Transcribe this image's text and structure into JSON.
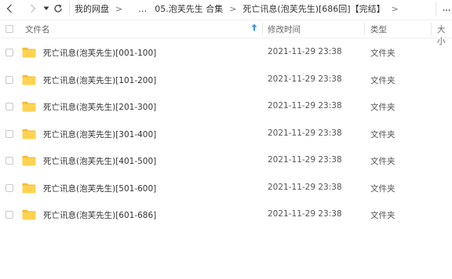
{
  "nav": {
    "breadcrumbs": [
      "我的网盘",
      "…",
      "05.泡芙先生 合集",
      "死亡讯息(泡芙先生)[686回]【完结】"
    ],
    "separator": ">"
  },
  "columns": {
    "name": "文件名",
    "modified": "修改时间",
    "type": "类型",
    "size": "大小"
  },
  "files": [
    {
      "name": "死亡讯息(泡芙先生)[001-100]",
      "modified": "2021-11-29 23:38",
      "type": "文件夹"
    },
    {
      "name": "死亡讯息(泡芙先生)[101-200]",
      "modified": "2021-11-29 23:38",
      "type": "文件夹"
    },
    {
      "name": "死亡讯息(泡芙先生)[201-300]",
      "modified": "2021-11-29 23:38",
      "type": "文件夹"
    },
    {
      "name": "死亡讯息(泡芙先生)[301-400]",
      "modified": "2021-11-29 23:38",
      "type": "文件夹"
    },
    {
      "name": "死亡讯息(泡芙先生)[401-500]",
      "modified": "2021-11-29 23:38",
      "type": "文件夹"
    },
    {
      "name": "死亡讯息(泡芙先生)[501-600]",
      "modified": "2021-11-29 23:38",
      "type": "文件夹"
    },
    {
      "name": "死亡讯息(泡芙先生)[601-686]",
      "modified": "2021-11-29 23:38",
      "type": "文件夹"
    }
  ],
  "colors": {
    "folder": "#ffd351",
    "folder_tab": "#f5bd2c",
    "sort_arrow": "#3a8ee6"
  }
}
